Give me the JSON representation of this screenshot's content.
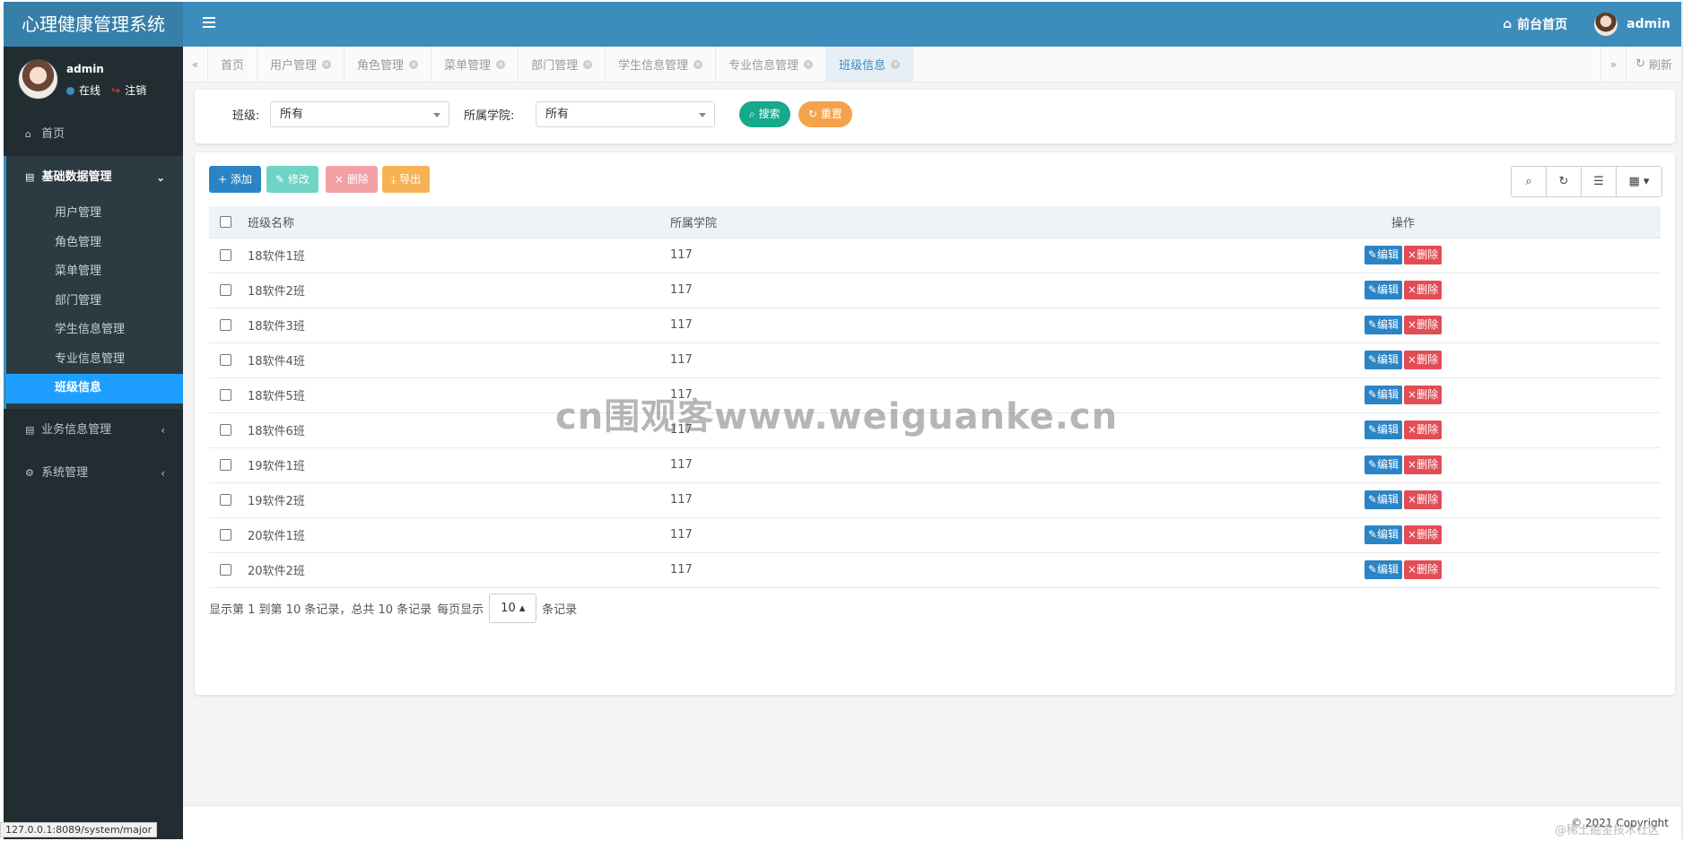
{
  "app": {
    "title": "心理健康管理系统"
  },
  "navbar": {
    "home_link": "前台首页",
    "user": "admin"
  },
  "sidebar": {
    "user": {
      "name": "admin",
      "online": "在线",
      "logout": "注销"
    },
    "home": "首页",
    "group_basic": {
      "label": "基础数据管理",
      "items": [
        "用户管理",
        "角色管理",
        "菜单管理",
        "部门管理",
        "学生信息管理",
        "专业信息管理",
        "班级信息"
      ]
    },
    "group_business": "业务信息管理",
    "group_system": "系统管理"
  },
  "tabs": [
    "首页",
    "用户管理",
    "角色管理",
    "菜单管理",
    "部门管理",
    "学生信息管理",
    "专业信息管理",
    "班级信息"
  ],
  "tabbar": {
    "refresh": "刷新"
  },
  "search": {
    "class_label": "班级:",
    "class_value": "所有",
    "college_label": "所属学院:",
    "college_value": "所有",
    "search_btn": "搜索",
    "reset_btn": "重置"
  },
  "toolbar": {
    "add": "添加",
    "edit": "修改",
    "delete": "删除",
    "export": "导出"
  },
  "table": {
    "headers": [
      "班级名称",
      "所属学院",
      "操作"
    ],
    "edit_label": "编辑",
    "delete_label": "删除",
    "rows": [
      {
        "name": "18软件1班",
        "college": "117"
      },
      {
        "name": "18软件2班",
        "college": "117"
      },
      {
        "name": "18软件3班",
        "college": "117"
      },
      {
        "name": "18软件4班",
        "college": "117"
      },
      {
        "name": "18软件5班",
        "college": "117"
      },
      {
        "name": "18软件6班",
        "college": "117"
      },
      {
        "name": "19软件1班",
        "college": "117"
      },
      {
        "name": "19软件2班",
        "college": "117"
      },
      {
        "name": "20软件1班",
        "college": "117"
      },
      {
        "name": "20软件2班",
        "college": "117"
      }
    ]
  },
  "pager": {
    "summary": "显示第 1 到第 10 条记录，总共 10 条记录",
    "per_page_label": "每页显示",
    "page_size": "10",
    "suffix": "条记录"
  },
  "footer": {
    "copyright": "© 2021 Copyright",
    "juejin": "@稀土掘金技术社区"
  },
  "status_url": "127.0.0.1:8089/system/major",
  "watermark": "cn围观客www.weiguanke.cn",
  "colors": {
    "navbar": "#3c8dbc",
    "logo": "#367fa9",
    "sidebar": "#222d32",
    "active": "#1e9fff",
    "add": "#2b84c6",
    "edit": "#6fd3c5",
    "delete": "#f2a0a5",
    "export": "#f7b255",
    "search": "#16a98c",
    "reset": "#f5a34b"
  }
}
